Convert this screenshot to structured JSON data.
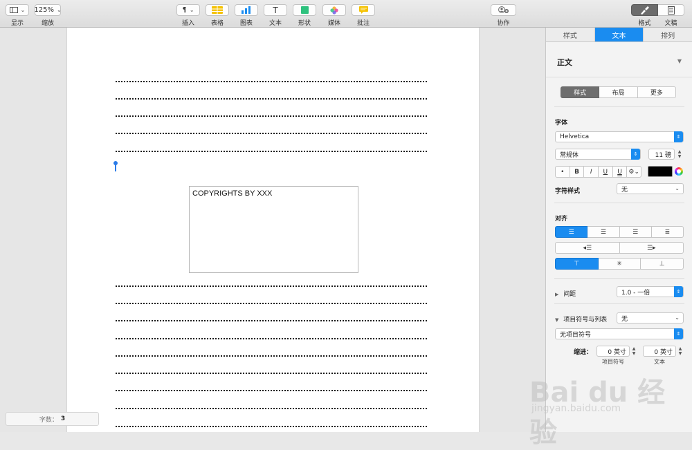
{
  "toolbar": {
    "view": {
      "label": "显示"
    },
    "zoom": {
      "value": "125%",
      "label": "缩放"
    },
    "insert": {
      "glyph": "¶",
      "label": "插入"
    },
    "table": {
      "label": "表格"
    },
    "chart": {
      "label": "图表"
    },
    "text": {
      "glyph": "T",
      "label": "文本"
    },
    "shape": {
      "label": "形状"
    },
    "media": {
      "label": "媒体"
    },
    "comment": {
      "label": "批注"
    },
    "collaborate": {
      "label": "协作"
    },
    "format": {
      "label": "格式"
    },
    "document": {
      "label": "文稿"
    }
  },
  "document": {
    "textbox_text": "COPYRIGHTS BY XXX",
    "word_count_label": "字数：",
    "word_count": "3"
  },
  "inspector": {
    "tabs": [
      "样式",
      "文本",
      "排列"
    ],
    "active_tab": "文本",
    "paragraph_style": "正文",
    "subtabs": [
      "样式",
      "布局",
      "更多"
    ],
    "font_label": "字体",
    "font_family": "Helvetica",
    "font_style": "常规体",
    "font_size": "11 磅",
    "format_buttons": [
      "•",
      "B",
      "I",
      "U",
      "U"
    ],
    "font_color": "#000000",
    "char_style_label": "字符样式",
    "char_style_value": "无",
    "align_label": "对齐",
    "spacing_label": "间距",
    "spacing_value": "1.0 - 一倍",
    "bullets_label": "项目符号与列表",
    "bullets_value": "无",
    "bullet_type": "无项目符号",
    "indent_label": "缩进：",
    "indent_bullet_value": "0 英寸",
    "indent_bullet_label": "项目符号",
    "indent_text_value": "0 英寸",
    "indent_text_label": "文本"
  },
  "watermark": {
    "text": "Bai du 经验",
    "url": "jingyan.baidu.com"
  },
  "colors": {
    "accent": "#1a8cf0",
    "cursor": "#2a7be8"
  }
}
